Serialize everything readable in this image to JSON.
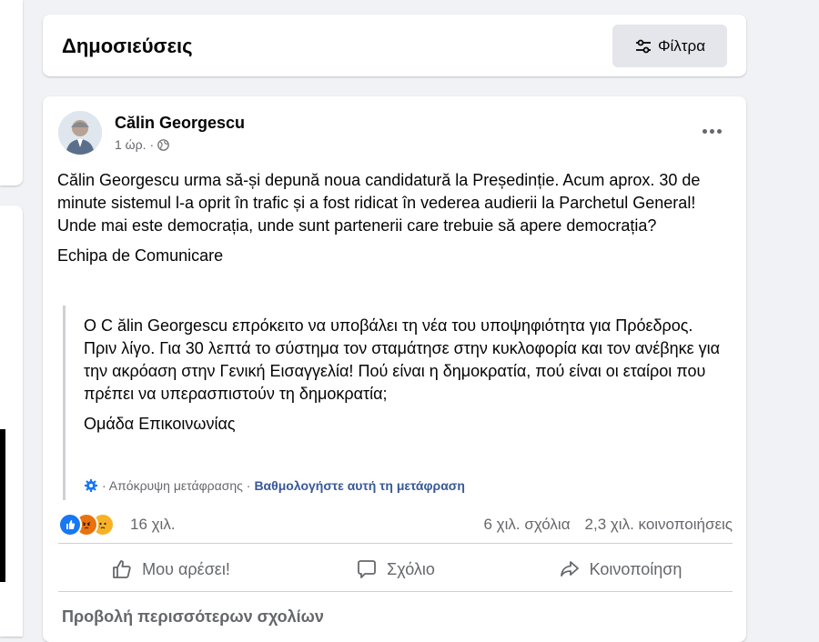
{
  "header": {
    "title": "Δημοσιεύσεις",
    "filter_label": "Φίλτρα"
  },
  "post": {
    "author": "Călin Georgescu",
    "time": "1 ώρ.",
    "separator": "·",
    "privacy_icon": "globe-icon",
    "text": "Călin Georgescu urma să-și depună noua candidatură la Președinție. Acum aprox. 30 de minute sistemul l-a oprit în trafic și a fost ridicat în vederea audierii la Parchetul General! Unde mai este democrația, unde sunt partenerii care trebuie să apere democrația?",
    "signature": "Echipa de Comunicare",
    "translation": {
      "text": "Ο C ălin Georgescu επρόκειτο να υποβάλει τη νέα του υποψηφιότητα για Πρόεδρος. Πριν λίγο. Για 30 λεπτά το σύστημα τον σταμάτησε στην κυκλοφορία και τον ανέβηκε για την ακρόαση στην Γενική Εισαγγελία! Πού είναι η δημοκρατία, πού είναι οι εταίροι που πρέπει να υπερασπιστούν τη δημοκρατία;",
      "signature": "Ομάδα Επικοινωνίας",
      "hide_label": "· Απόκρυψη μετάφρασης ·",
      "rate_label": "Βαθμολογήστε αυτή τη μετάφραση"
    },
    "reactions": {
      "count": "16 χιλ.",
      "comments": "6 χιλ. σχόλια",
      "shares": "2,3 χιλ. κοινοποιήσεις",
      "types": [
        "like",
        "angry",
        "sad"
      ]
    },
    "actions": {
      "like": "Μου αρέσει!",
      "comment": "Σχόλιο",
      "share": "Κοινοποίηση"
    },
    "more_comments": "Προβολή περισσότερων σχολίων"
  },
  "colors": {
    "background": "#f0f2f5",
    "card": "#ffffff",
    "secondary_text": "#65676b",
    "like_blue": "#1877f2",
    "angry": "#e9710f",
    "sad": "#f7b125"
  }
}
